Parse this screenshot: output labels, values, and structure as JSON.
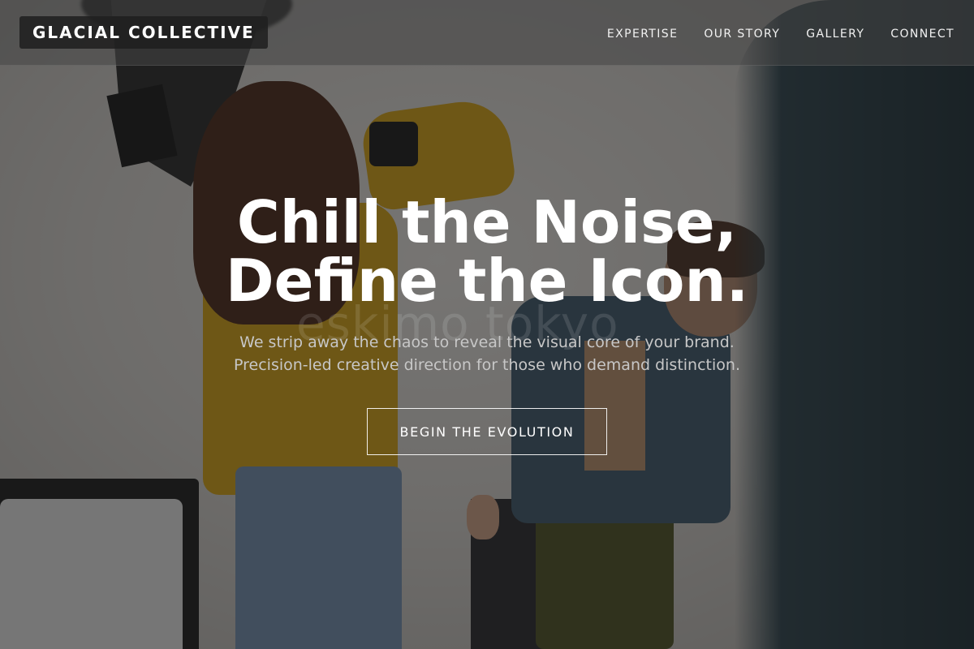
{
  "brand": {
    "name": "GLACIAL COLLECTIVE"
  },
  "nav": {
    "items": [
      {
        "label": "EXPERTISE"
      },
      {
        "label": "OUR STORY"
      },
      {
        "label": "GALLERY"
      },
      {
        "label": "CONNECT"
      }
    ]
  },
  "hero": {
    "title_line1": "Chill the Noise,",
    "title_line2": "Define the Icon.",
    "subtitle_line1": "We strip away the chaos to reveal the visual core of your brand.",
    "subtitle_line2": "Precision-led creative direction for those who demand distinction.",
    "cta_label": "BEGIN THE EVOLUTION",
    "background_watermark": "eskimo tokyo"
  },
  "colors": {
    "overlay": "#141414",
    "text_primary": "#ffffff",
    "text_secondary": "#c7c7c7",
    "sweater_yellow": "#c99a18"
  }
}
